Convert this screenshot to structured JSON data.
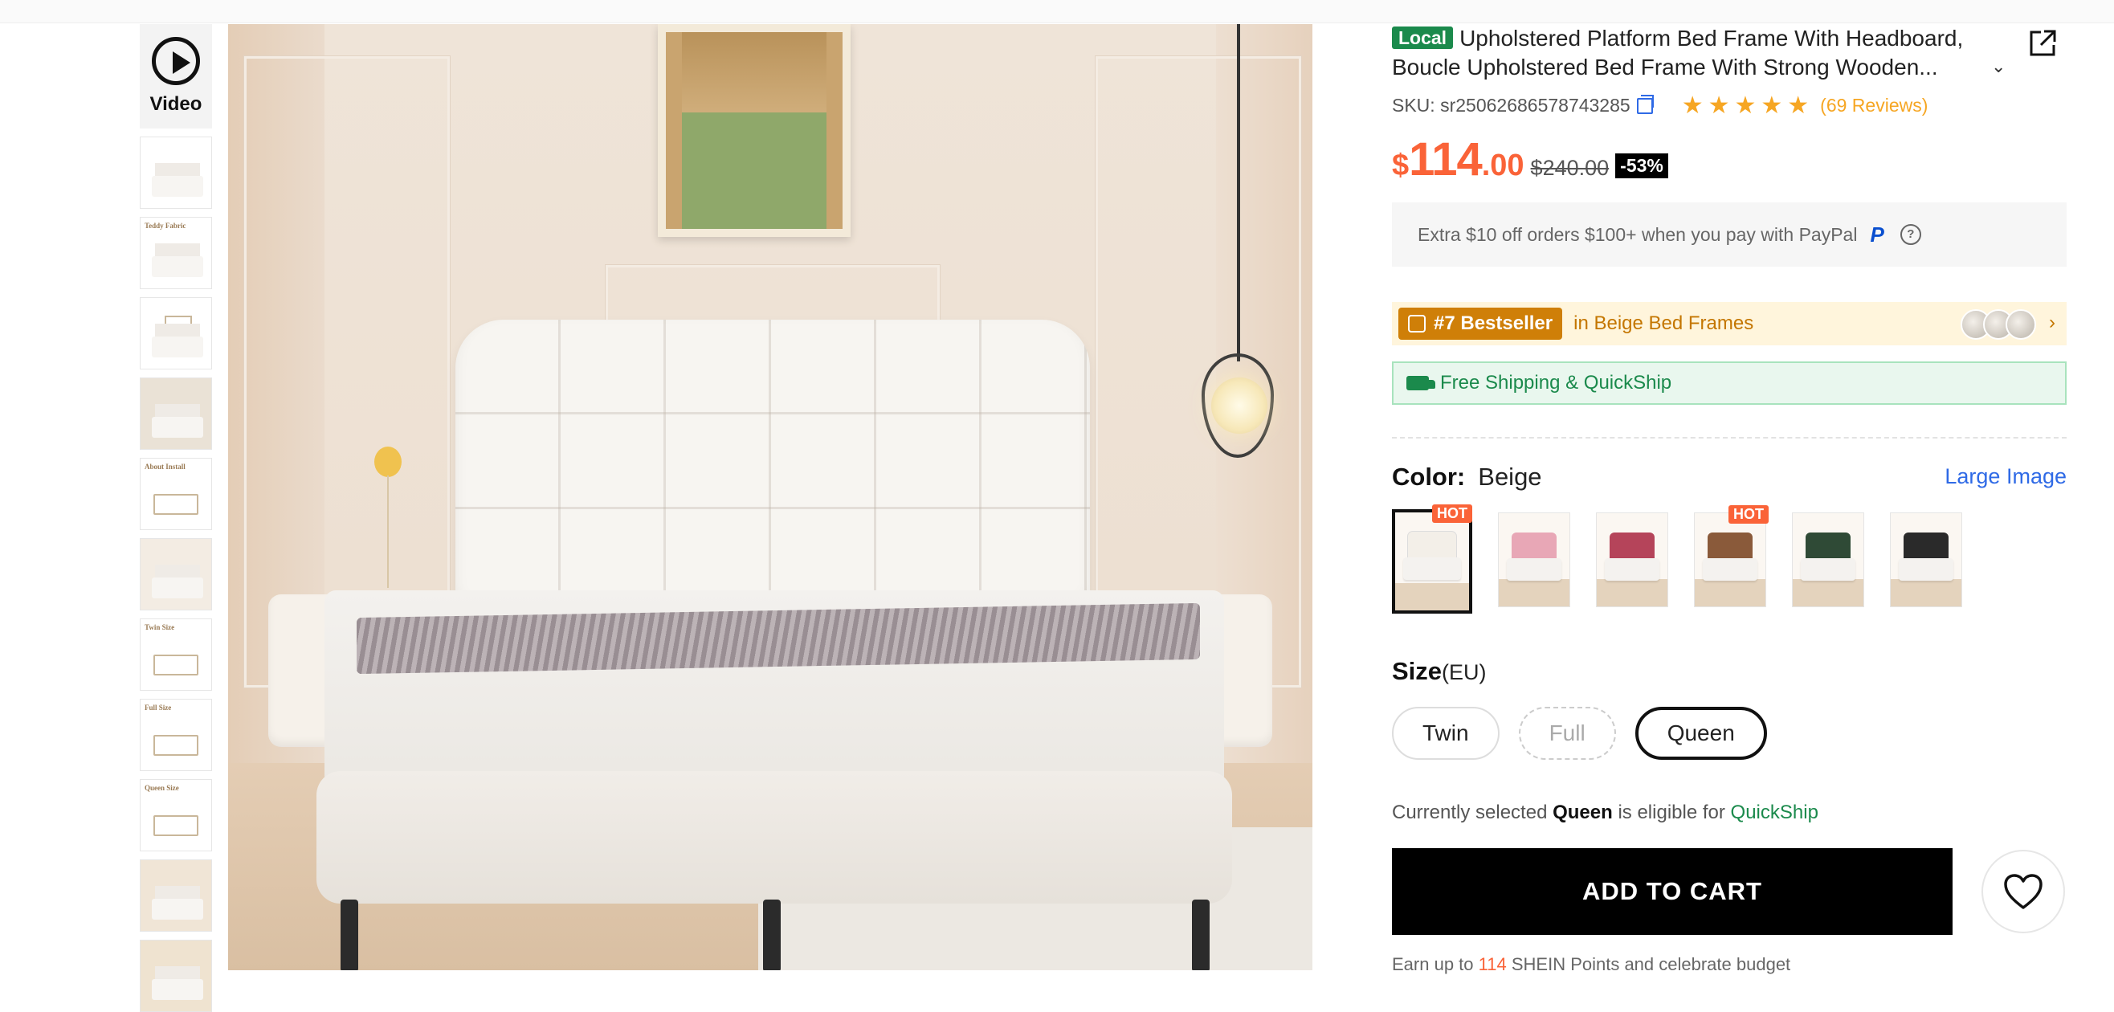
{
  "video": {
    "label": "Video"
  },
  "thumbnails": [
    {
      "caption": ""
    },
    {
      "caption": "Teddy Fabric"
    },
    {
      "caption": ""
    },
    {
      "caption": ""
    },
    {
      "caption": "About Install"
    },
    {
      "caption": ""
    },
    {
      "caption": "Twin Size"
    },
    {
      "caption": "Full Size"
    },
    {
      "caption": "Queen Size"
    },
    {
      "caption": ""
    },
    {
      "caption": ""
    }
  ],
  "product": {
    "badge": "Local",
    "title": "Upholstered Platform Bed Frame With Headboard, Boucle Upholstered Bed Frame With Strong Wooden...",
    "sku": "SKU: sr25062686578743285",
    "rating_stars": "★★★★★",
    "reviews": "(69 Reviews)",
    "currency": "$",
    "price_int": "114",
    "price_dec": ".00",
    "old_price": "$240.00",
    "discount": "-53%",
    "promo_text": "Extra $10 off orders $100+ when you pay with PayPal",
    "paypal_glyph": "P",
    "help_glyph": "?",
    "bestseller_rank": "#7 Bestseller",
    "bestseller_category": "in Beige Bed Frames",
    "shipping_text": "Free Shipping & QuickShip",
    "color_label": "Color:",
    "color_value": "Beige",
    "large_image_link": "Large Image",
    "hot_label": "HOT",
    "size_label": "Size",
    "size_unit": "(EU)",
    "sizes": [
      "Twin",
      "Full",
      "Queen"
    ],
    "eligible_prefix": "Currently selected",
    "eligible_size": "Queen",
    "eligible_mid": "is eligible for",
    "eligible_program": "QuickShip",
    "add_to_cart": "ADD TO CART",
    "earn_prefix": "Earn up to",
    "earn_points": "114",
    "earn_suffix": "SHEIN Points and celebrate budget"
  },
  "swatches": [
    {
      "name": "beige",
      "hot": true,
      "selected": true,
      "color": "#f3efe8"
    },
    {
      "name": "pink",
      "hot": false,
      "selected": false,
      "color": "#e8a7b6"
    },
    {
      "name": "red",
      "hot": false,
      "selected": false,
      "color": "#b5445a"
    },
    {
      "name": "brown",
      "hot": true,
      "selected": false,
      "color": "#8a5a3a"
    },
    {
      "name": "green",
      "hot": false,
      "selected": false,
      "color": "#2f4a36"
    },
    {
      "name": "black",
      "hot": false,
      "selected": false,
      "color": "#2a2a2a"
    }
  ],
  "colors": {
    "accent_price": "#fa6338",
    "local_green": "#1b8a4c",
    "link_blue": "#2f6ae6",
    "bestseller_orange": "#cf7f08"
  },
  "icons": {
    "play": "play-icon",
    "share": "share-external-icon",
    "copy": "copy-icon",
    "heart": "heart-icon",
    "truck": "truck-icon",
    "chevron": "chevron-down-icon"
  }
}
